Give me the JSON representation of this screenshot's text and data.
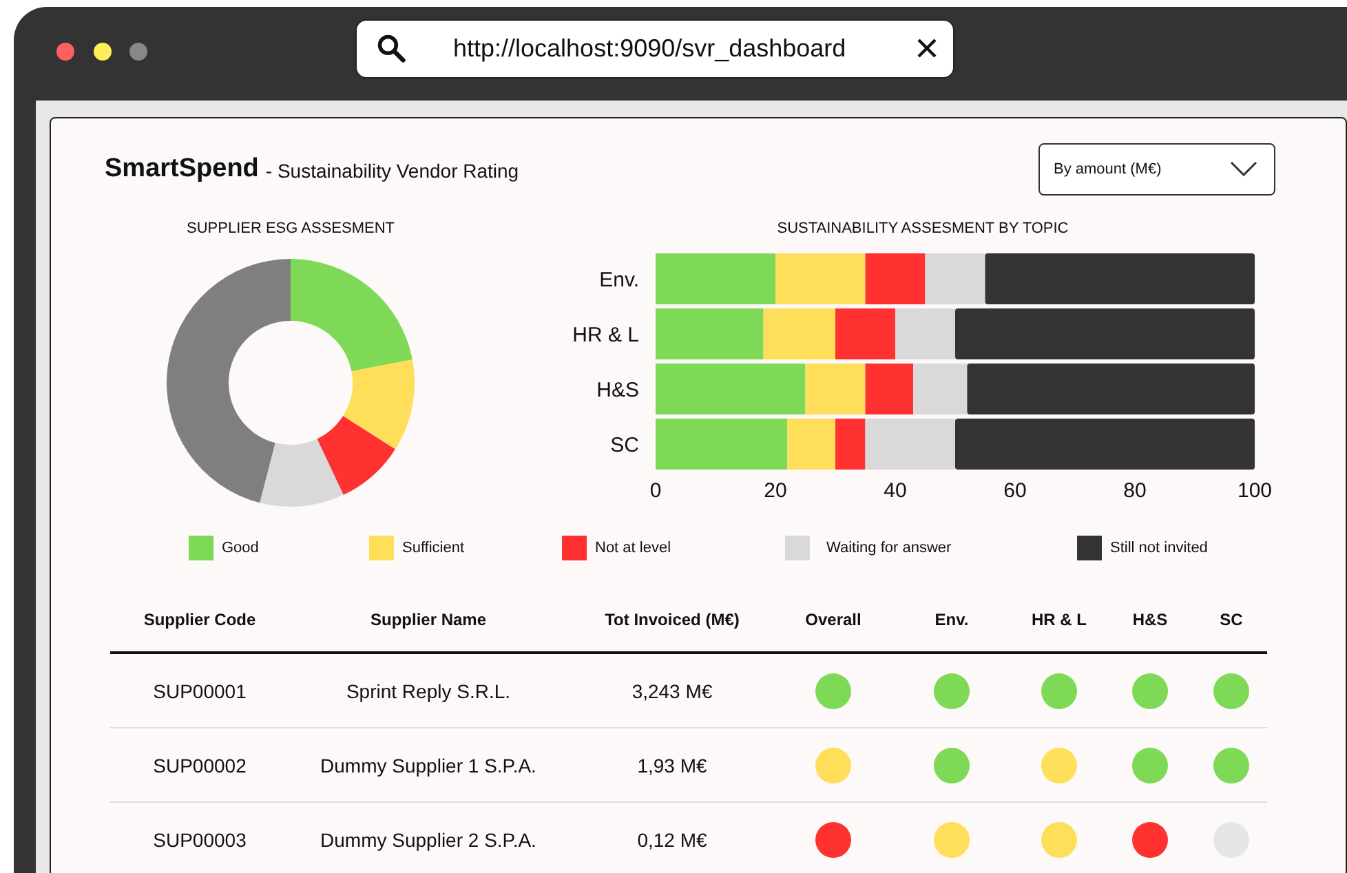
{
  "browser": {
    "url": "http://localhost:9090/svr_dashboard"
  },
  "header": {
    "brand": "SmartSpend",
    "subtitle": "- Sustainability Vendor Rating",
    "dropdown": {
      "value": "By amount (M€)"
    }
  },
  "esg_chart": {
    "title": "SUPPLIER ESG ASSESMENT"
  },
  "topic_chart": {
    "chart_data": {
      "type": "bar",
      "title": "SUSTAINABILITY ASSESMENT BY TOPIC",
      "orientation": "horizontal",
      "stacked": true,
      "categories": [
        "Env.",
        "HR & L",
        "H&S",
        "SC"
      ],
      "xlim": [
        0,
        100
      ],
      "xticks": [
        0,
        20,
        40,
        60,
        80,
        100
      ],
      "series": [
        {
          "name": "Good",
          "color": "#7ed957",
          "values": [
            20,
            18,
            25,
            22
          ]
        },
        {
          "name": "Sufficient",
          "color": "#ffde59",
          "values": [
            15,
            12,
            10,
            8
          ]
        },
        {
          "name": "Not at level",
          "color": "#ff3131",
          "values": [
            10,
            10,
            8,
            5
          ]
        },
        {
          "name": "Waiting for answer",
          "color": "#d9d9d9",
          "values": [
            10,
            10,
            9,
            15
          ]
        },
        {
          "name": "Still not invited",
          "color": "#333333",
          "values": [
            45,
            50,
            48,
            50
          ]
        }
      ]
    }
  },
  "table": {
    "columns": [
      "Supplier Code",
      "Supplier Name",
      "Tot Invoiced (M€)",
      "Overall",
      "Env.",
      "HR & L",
      "H&S",
      "SC"
    ],
    "rows": [
      {
        "code": "SUP00001",
        "name": "Sprint Reply S.R.L.",
        "invoiced": "3,243 M€",
        "ratings": [
          {
            "color": "#7ed957"
          },
          {
            "color": "#7ed957"
          },
          {
            "color": "#7ed957"
          },
          {
            "color": "#7ed957"
          },
          {
            "color": "#7ed957"
          }
        ]
      },
      {
        "code": "SUP00002",
        "name": "Dummy Supplier 1 S.P.A.",
        "invoiced": "1,93 M€",
        "ratings": [
          {
            "color": "#ffde59"
          },
          {
            "color": "#7ed957"
          },
          {
            "color": "#ffde59"
          },
          {
            "color": "#7ed957"
          },
          {
            "color": "#7ed957"
          }
        ]
      },
      {
        "code": "SUP00003",
        "name": "Dummy Supplier 2 S.P.A.",
        "invoiced": "0,12 M€",
        "ratings": [
          {
            "color": "#ff3131"
          },
          {
            "color": "#ffde59"
          },
          {
            "color": "#ffde59"
          },
          {
            "color": "#ff3131"
          },
          {
            "color": "#e6e6e6"
          }
        ]
      }
    ]
  }
}
